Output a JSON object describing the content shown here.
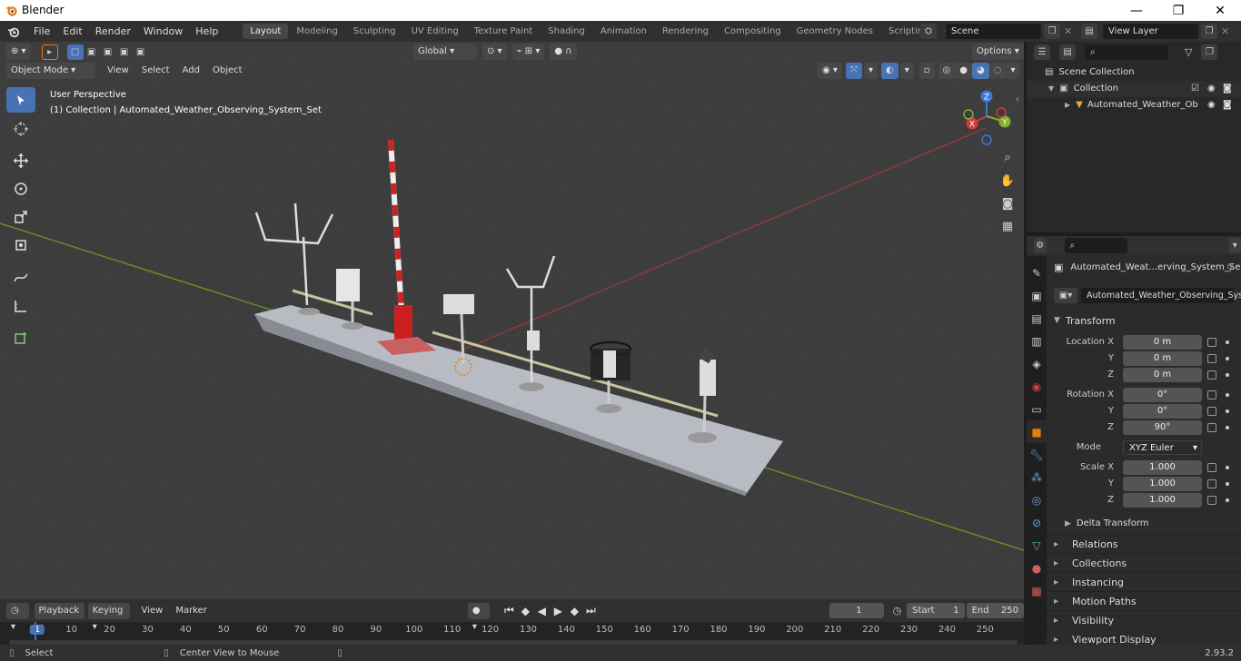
{
  "window": {
    "title": "Blender",
    "minimize": "—",
    "maximize": "❐",
    "close": "✕"
  },
  "menu": {
    "items": [
      "File",
      "Edit",
      "Render",
      "Window",
      "Help"
    ]
  },
  "workspaces": {
    "tabs": [
      "Layout",
      "Modeling",
      "Sculpting",
      "UV Editing",
      "Texture Paint",
      "Shading",
      "Animation",
      "Rendering",
      "Compositing",
      "Geometry Nodes",
      "Scripting"
    ],
    "active": "Layout",
    "add": "+"
  },
  "scene": {
    "name": "Scene",
    "view_layer": "View Layer"
  },
  "viewport": {
    "mode": "Object Mode",
    "menus": [
      "View",
      "Select",
      "Add",
      "Object"
    ],
    "orientation": "Global",
    "options": "Options",
    "overlay_line1": "User Perspective",
    "overlay_line2": "(1) Collection | Automated_Weather_Observing_System_Set",
    "gizmo": {
      "z": "Z",
      "y": "Y",
      "x": "X"
    },
    "colors": {
      "grid": "#3d3d3d",
      "x_axis": "#8c3a3a",
      "y_axis": "#6b8a26",
      "accent": "#4772b3"
    }
  },
  "outliner": {
    "scene_collection": "Scene Collection",
    "collection": "Collection",
    "object": "Automated_Weather_Ob"
  },
  "properties": {
    "object_name": "Automated_Weat...erving_System_Se",
    "data_name": "Automated_Weather_Observing_Syste...",
    "transform_title": "Transform",
    "location_label": "Location X",
    "rotation_label": "Rotation X",
    "scale_label": "Scale X",
    "y_label": "Y",
    "z_label": "Z",
    "location": [
      "0 m",
      "0 m",
      "0 m"
    ],
    "rotation": [
      "0°",
      "0°",
      "90°"
    ],
    "mode_label": "Mode",
    "mode_value": "XYZ Euler",
    "scale": [
      "1.000",
      "1.000",
      "1.000"
    ],
    "delta": "Delta Transform",
    "panels": [
      "Relations",
      "Collections",
      "Instancing",
      "Motion Paths",
      "Visibility",
      "Viewport Display"
    ]
  },
  "timeline": {
    "menus": [
      "Playback",
      "Keying",
      "View",
      "Marker"
    ],
    "current_frame": "1",
    "start_label": "Start",
    "start": "1",
    "end_label": "End",
    "end": "250",
    "ruler": [
      "1",
      "10",
      "20",
      "30",
      "40",
      "50",
      "60",
      "70",
      "80",
      "90",
      "100",
      "110",
      "120",
      "130",
      "140",
      "150",
      "160",
      "170",
      "180",
      "190",
      "200",
      "210",
      "220",
      "230",
      "240",
      "250"
    ]
  },
  "status": {
    "left": "Select",
    "middle": "Center View to Mouse",
    "version": "2.93.2"
  }
}
